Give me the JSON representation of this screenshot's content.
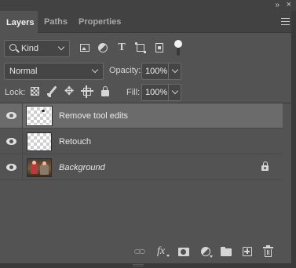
{
  "panel": {
    "collapse_icon": "double-chevron-right",
    "close_icon": "close-x"
  },
  "tabs": [
    {
      "label": "Layers",
      "active": true
    },
    {
      "label": "Paths",
      "active": false
    },
    {
      "label": "Properties",
      "active": false
    }
  ],
  "filter": {
    "kind_label": "Kind",
    "filter_icons": [
      "pixel-layer-filter",
      "adjustment-layer-filter",
      "type-layer-filter",
      "shape-layer-filter",
      "smart-object-filter"
    ]
  },
  "blend": {
    "mode": "Normal",
    "opacity_label": "Opacity:",
    "opacity_value": "100%"
  },
  "locks": {
    "label": "Lock:",
    "icons": [
      "lock-transparent-pixels",
      "lock-image-pixels",
      "lock-position",
      "lock-artboard",
      "lock-all"
    ],
    "fill_label": "Fill:",
    "fill_value": "100%"
  },
  "layers": [
    {
      "name": "Remove tool edits",
      "visible": true,
      "selected": true,
      "italic": false,
      "locked": false
    },
    {
      "name": "Retouch",
      "visible": true,
      "selected": false,
      "italic": false,
      "locked": false
    },
    {
      "name": "Background",
      "visible": true,
      "selected": false,
      "italic": true,
      "locked": true
    }
  ],
  "bottom_icons": [
    "link-layers",
    "add-layer-style",
    "add-layer-mask",
    "new-fill-adjustment-layer",
    "new-group",
    "new-layer",
    "delete-layer"
  ],
  "colors": {
    "panel_bg": "#535353",
    "tab_bar_bg": "#424242",
    "selected_row": "#6b6b6b"
  }
}
